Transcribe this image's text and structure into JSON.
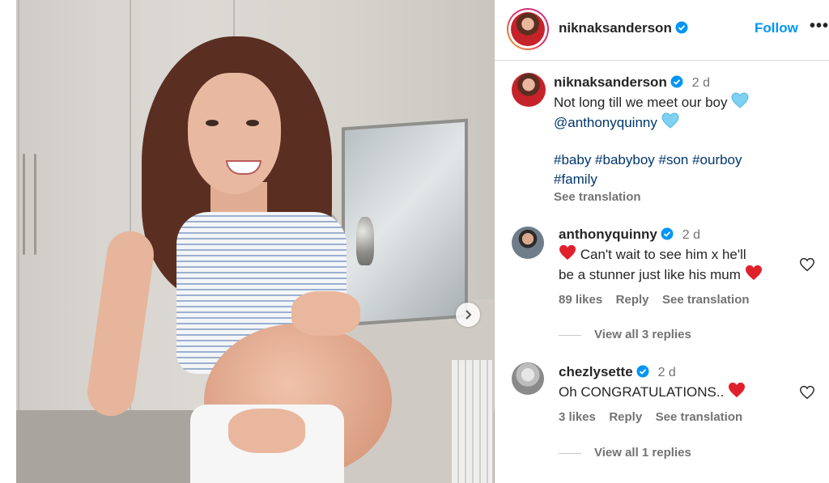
{
  "post": {
    "author": "niknaksanderson",
    "follow_label": "Follow",
    "more_label": "•••",
    "caption": {
      "username": "niknaksanderson",
      "time": "2 d",
      "line1": "Not long till we meet our boy",
      "mention": "@anthonyquinny",
      "hashtags_line1": "#baby #babyboy #son #ourboy",
      "hashtags_line2": "#family",
      "see_translation": "See translation"
    }
  },
  "comments": [
    {
      "username": "anthonyquinny",
      "time": "2 d",
      "line1": "Can't wait to see him x he'll",
      "line2": "be a stunner just like his mum",
      "likes": "89 likes",
      "reply": "Reply",
      "see_translation": "See translation",
      "view_replies": "View all 3 replies"
    },
    {
      "username": "chezlysette",
      "time": "2 d",
      "line1": "Oh CONGRATULATIONS..",
      "likes": "3 likes",
      "reply": "Reply",
      "see_translation": "See translation",
      "view_replies": "View all 1 replies"
    }
  ],
  "colors": {
    "accent": "#0095f6",
    "verified": "#0095f6",
    "link": "#00376b",
    "muted": "#737373"
  },
  "icons": {
    "verified": "verified-badge-icon",
    "heart": "heart-outline-icon",
    "blue_heart": "blue-heart-emoji",
    "red_heart": "red-heart-emoji",
    "next": "chevron-right-icon"
  }
}
